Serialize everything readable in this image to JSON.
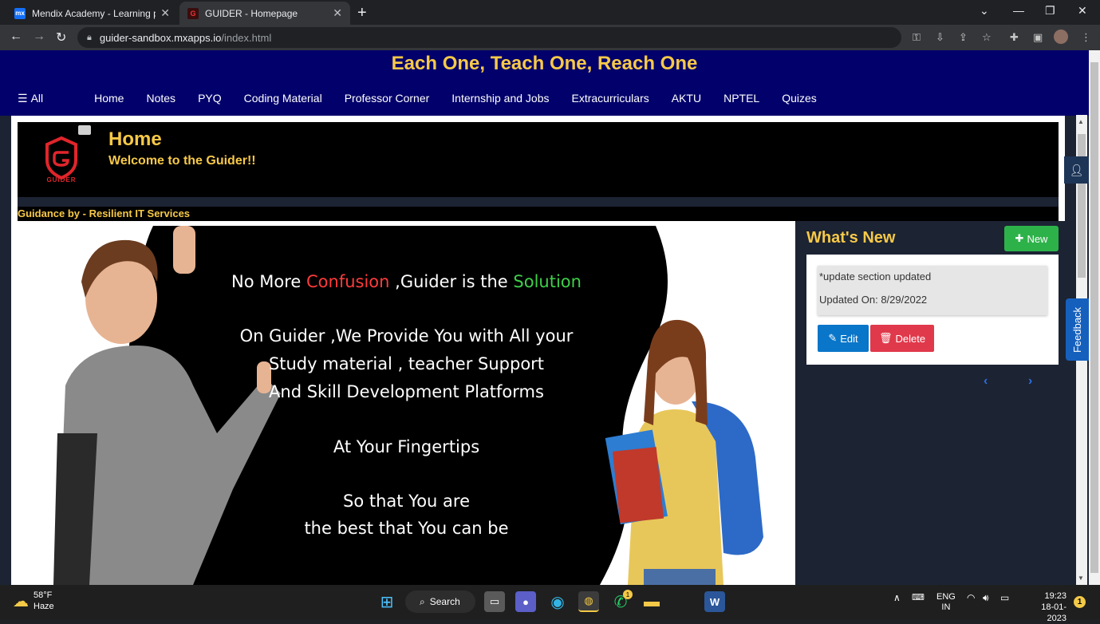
{
  "browser": {
    "tabs": [
      {
        "title": "Mendix Academy - Learning path",
        "favicon": "mx",
        "active": false
      },
      {
        "title": "GUIDER - Homepage",
        "favicon": "guider",
        "active": true
      }
    ],
    "new_tab_label": "+",
    "url_host": "guider-sandbox.mxapps.io",
    "url_path": "/index.html"
  },
  "site": {
    "tagline": "Each One, Teach One, Reach One",
    "nav": {
      "all_label": "All",
      "items": [
        "Home",
        "Notes",
        "PYQ",
        "Coding Material",
        "Professor Corner",
        "Internship and Jobs",
        "Extracurriculars",
        "AKTU",
        "NPTEL",
        "Quizes"
      ]
    }
  },
  "banner": {
    "title": "Home",
    "subtitle": "Welcome to the Guider!!",
    "logo_text": "GUIDER"
  },
  "guidance": "Guidance by - Resilient IT Services",
  "hero": {
    "line1_a": "No More ",
    "line1_b": "Confusion",
    "line1_c": " ,Guider is the ",
    "line1_d": "Solution",
    "line2": "On Guider ,We Provide You with All your",
    "line3": "Study material , teacher Support",
    "line4": "And Skill Development Platforms",
    "line5": "At Your Fingertips",
    "line6": "So that You are",
    "line7": "the best that You can be"
  },
  "whats_new": {
    "heading": "What's New",
    "new_button": "New",
    "note_text": "*update section updated",
    "updated_on": "Updated On: 8/29/2022",
    "edit_label": "Edit",
    "delete_label": "Delete",
    "prev_icon": "chevron-left-icon",
    "next_icon": "chevron-right-icon"
  },
  "side": {
    "feedback_label": "Feedback"
  },
  "taskbar": {
    "temperature": "58°F",
    "condition": "Haze",
    "search_label": "Search",
    "lang": "ENG",
    "region": "IN",
    "time": "19:23",
    "date": "18-01-2023",
    "notification_count": "1",
    "whatsapp_badge": "1"
  },
  "colors": {
    "header_bg": "#02006b",
    "accent_gold": "#f7c948",
    "page_bg": "#1c2333",
    "new_green": "#2db24a",
    "edit_blue": "#0a76c9",
    "delete_red": "#e0394b",
    "feedback_blue": "#1560bd"
  }
}
